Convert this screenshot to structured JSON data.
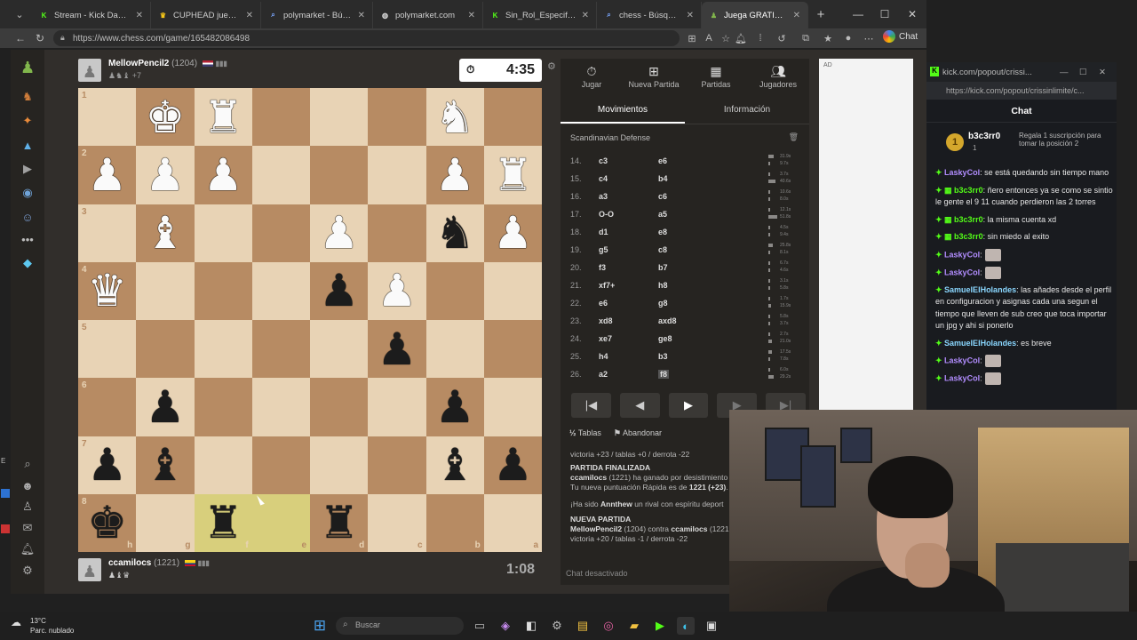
{
  "browser": {
    "tabs": [
      {
        "label": "Stream - Kick Dashboard",
        "icon": "kick-icon",
        "color": "#53fc18"
      },
      {
        "label": "CUPHEAD juego gratis",
        "icon": "crown-icon",
        "color": "#f5c518"
      },
      {
        "label": "polymarket - Búsqueda",
        "icon": "search-icon",
        "color": "#7aa7ff"
      },
      {
        "label": "polymarket.com",
        "icon": "globe-icon",
        "color": "#ddd"
      },
      {
        "label": "Sin_Rol_Especifico Stream",
        "icon": "kick-icon",
        "color": "#53fc18"
      },
      {
        "label": "chess - Búsqueda",
        "icon": "search-icon",
        "color": "#7aa7ff"
      },
      {
        "label": "Juega GRATIS al ajedrez",
        "icon": "pawn-icon",
        "color": "#81b64c"
      }
    ],
    "url": "https://www.chess.com/game/165482086498",
    "chat_button": "Chat"
  },
  "game": {
    "top_player": {
      "name": "MellowPencil2",
      "rating": "(1204)",
      "extra": "+7",
      "clock": "4:35"
    },
    "bottom_player": {
      "name": "ccamilocs",
      "rating": "(1221)",
      "clock": "1:08"
    },
    "board": {
      "rank_labels": [
        "1",
        "2",
        "3",
        "4",
        "5",
        "6",
        "7",
        "8"
      ],
      "file_labels": [
        "h",
        "g",
        "f",
        "e",
        "d",
        "c",
        "b",
        "a"
      ],
      "rows": [
        [
          "",
          "wK",
          "wR",
          "",
          "",
          "",
          "wN",
          ""
        ],
        [
          "wP",
          "wP",
          "wP",
          "",
          "",
          "",
          "wP",
          "wR"
        ],
        [
          "",
          "wB",
          "",
          "",
          "wP",
          "",
          "bN",
          "wP"
        ],
        [
          "wQ",
          "",
          "",
          "",
          "bP",
          "wP",
          "",
          ""
        ],
        [
          "",
          "",
          "",
          "",
          "",
          "bP",
          "",
          ""
        ],
        [
          "",
          "bP",
          "",
          "",
          "",
          "",
          "bP",
          ""
        ],
        [
          "bP",
          "bB",
          "",
          "",
          "",
          "",
          "bB",
          "bP"
        ],
        [
          "bK",
          "",
          "bR",
          "",
          "bR",
          "",
          "",
          ""
        ]
      ],
      "highlights": [
        [
          7,
          2
        ],
        [
          7,
          3
        ]
      ]
    }
  },
  "panel": {
    "nav": [
      {
        "label": "Jugar",
        "icon": "clock-icon"
      },
      {
        "label": "Nueva Partida",
        "icon": "plus-icon"
      },
      {
        "label": "Partidas",
        "icon": "board-icon"
      },
      {
        "label": "Jugadores",
        "icon": "users-icon"
      }
    ],
    "tabs": [
      "Movimientos",
      "Información"
    ],
    "opening": "Scandinavian Defense",
    "moves": [
      {
        "n": "14.",
        "w": "c3",
        "b": "e6",
        "wt": "31.9s",
        "bt": "9.7s"
      },
      {
        "n": "15.",
        "w": "c4",
        "b": "b4",
        "wt": "3.7s",
        "bt": "40.6s"
      },
      {
        "n": "16.",
        "w": "a3",
        "b": "c6",
        "wt": "10.6s",
        "bt": "8.0s"
      },
      {
        "n": "17.",
        "w": "O-O",
        "b": "a5",
        "wt": "12.1s",
        "bt": "51.8s"
      },
      {
        "n": "18.",
        "w": "d1",
        "b": "e8",
        "wt": "4.5s",
        "bt": "9.4s"
      },
      {
        "n": "19.",
        "w": "g5",
        "b": "c8",
        "wt": "25.8s",
        "bt": "8.1s"
      },
      {
        "n": "20.",
        "w": "f3",
        "b": "b7",
        "wt": "6.7s",
        "bt": "4.6s"
      },
      {
        "n": "21.",
        "w": "xf7+",
        "b": "h8",
        "wt": "3.1s",
        "bt": "5.8s"
      },
      {
        "n": "22.",
        "w": "e6",
        "b": "g8",
        "wt": "1.7s",
        "bt": "15.9s"
      },
      {
        "n": "23.",
        "w": "xd8",
        "b": "axd8",
        "wt": "5.8s",
        "bt": "3.7s"
      },
      {
        "n": "24.",
        "w": "xe7",
        "b": "ge8",
        "wt": "2.7s",
        "bt": "21.0s"
      },
      {
        "n": "25.",
        "w": "h4",
        "b": "b3",
        "wt": "17.5s",
        "bt": "7.8s"
      },
      {
        "n": "26.",
        "w": "a2",
        "b": "f8",
        "wt": "6.0s",
        "bt": "29.2s"
      }
    ],
    "draw": "Tablas",
    "resign": "Abandonar",
    "log": {
      "l1": "victoria +23 / tablas +0 / derrota -22",
      "l2": "PARTIDA FINALIZADA",
      "l3_name": "ccamilocs",
      "l3_rest": " (1221) ha ganado por desistimiento",
      "l4_pre": "Tu nueva puntuación Rápida es de ",
      "l4_val": "1221 (+23)",
      "l4_post": ".",
      "l5_pre": "¡Ha sido ",
      "l5_name": "Annthew",
      "l5_post": " un rival con espíritu deport",
      "l6": "NUEVA PARTIDA",
      "l7_a": "MellowPencil2",
      "l7_b": " (1204) contra ",
      "l7_c": "ccamilocs",
      "l7_d": " (1221",
      "l8": "victoria +20 / tablas -1 / derrota -22"
    },
    "chat_off": "Chat desactivado",
    "ad": "AD"
  },
  "kick": {
    "window_title": "kick.com/popout/crissi...",
    "url": "https://kick.com/popout/crissinlimite/c...",
    "title": "Chat",
    "pinned": {
      "user": "b3c3rr0",
      "count": "1",
      "text": "Regala 1 suscripción para tomar la posición 2"
    },
    "messages": [
      {
        "user": "LaskyCol",
        "color": "#b28dff",
        "text": ": se está quedando sin tiempo mano",
        "badges": false,
        "emote": false
      },
      {
        "user": "b3c3rr0",
        "color": "#53fc18",
        "text": ": ñero entonces ya se como se sintio le gente el 9 11 cuando perdieron las 2 torres",
        "badges": true,
        "emote": false
      },
      {
        "user": "b3c3rr0",
        "color": "#53fc18",
        "text": ": la misma cuenta xd",
        "badges": true,
        "emote": false
      },
      {
        "user": "b3c3rr0",
        "color": "#53fc18",
        "text": ": sin miedo al exito",
        "badges": true,
        "emote": false
      },
      {
        "user": "LaskyCol",
        "color": "#b28dff",
        "text": ":",
        "badges": false,
        "emote": true
      },
      {
        "user": "LaskyCol",
        "color": "#b28dff",
        "text": ":",
        "badges": false,
        "emote": true
      },
      {
        "user": "SamuelElHolandes",
        "color": "#8ad7ff",
        "text": ": las añades desde el perfil en configuracion y asignas cada una segun el tiempo que lleven de sub creo que toca importar un jpg y ahi si ponerlo",
        "badges": false,
        "emote": false
      },
      {
        "user": "SamuelElHolandes",
        "color": "#8ad7ff",
        "text": ": es breve",
        "badges": false,
        "emote": false
      },
      {
        "user": "LaskyCol",
        "color": "#b28dff",
        "text": ":",
        "badges": false,
        "emote": true
      },
      {
        "user": "LaskyCol",
        "color": "#b28dff",
        "text": ":",
        "badges": false,
        "emote": true
      }
    ]
  },
  "taskbar": {
    "temp": "13°C",
    "weather": "Parc. nublado",
    "search_placeholder": "Buscar"
  }
}
